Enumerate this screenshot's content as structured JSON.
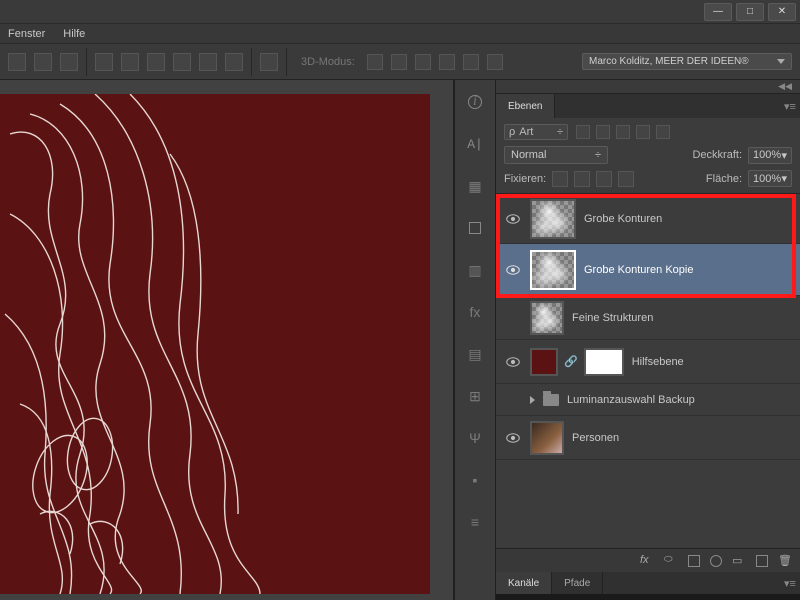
{
  "menu": {
    "fenster": "Fenster",
    "hilfe": "Hilfe"
  },
  "optionsbar": {
    "mode3d_label": "3D-Modus:",
    "author": "Marco Kolditz, MEER DER IDEEN®"
  },
  "layers_panel": {
    "tab": "Ebenen",
    "filter_label": "Art",
    "blend_mode": "Normal",
    "opacity_label": "Deckkraft:",
    "opacity_value": "100%",
    "lock_label": "Fixieren:",
    "fill_label": "Fläche:",
    "fill_value": "100%",
    "fx_label": "fx"
  },
  "layers": {
    "grobe": "Grobe Konturen",
    "grobe_kopie": "Grobe Konturen Kopie",
    "feine": "Feine Strukturen",
    "hilfs": "Hilfsebene",
    "luminanz": "Luminanzauswahl Backup",
    "personen": "Personen"
  },
  "channels_panel": {
    "kanale": "Kanäle",
    "pfade": "Pfade"
  }
}
